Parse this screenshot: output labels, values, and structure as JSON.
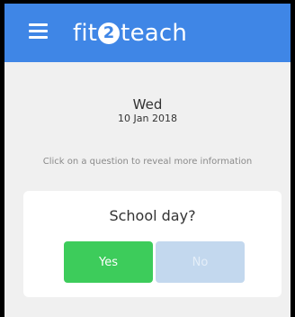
{
  "app": {
    "brand_prefix": "fit",
    "brand_middle": "2",
    "brand_suffix": "teach"
  },
  "date": {
    "day": "Wed",
    "full": "10 Jan 2018"
  },
  "hint": "Click on a question to reveal more information",
  "question": {
    "text": "School day?",
    "yes_label": "Yes",
    "no_label": "No"
  },
  "colors": {
    "appbar": "#3f86e6",
    "yes": "#3dcc5b",
    "no": "#c3d8ee"
  }
}
